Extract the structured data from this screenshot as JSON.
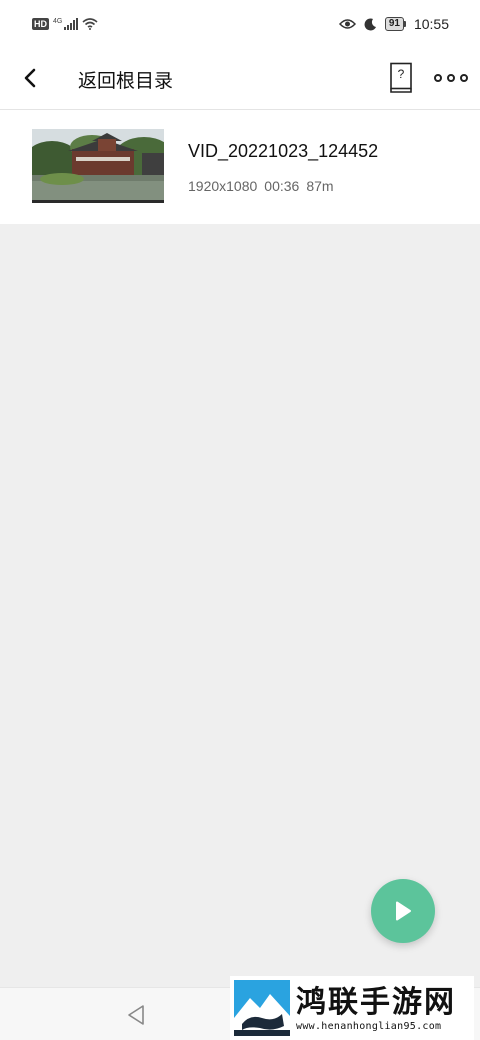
{
  "status_bar": {
    "hd": "HD",
    "network": "4G",
    "battery": "91",
    "time": "10:55"
  },
  "app_bar": {
    "title": "返回根目录",
    "help_glyph": "?"
  },
  "files": [
    {
      "name": "VID_20221023_124452",
      "resolution": "1920x1080",
      "duration": "00:36",
      "size": "87m"
    }
  ],
  "watermark": {
    "brand": "鸿联手游网",
    "url": "www.henanhonglian95.com"
  },
  "colors": {
    "accent": "#5cc49b",
    "background": "#efefef"
  }
}
